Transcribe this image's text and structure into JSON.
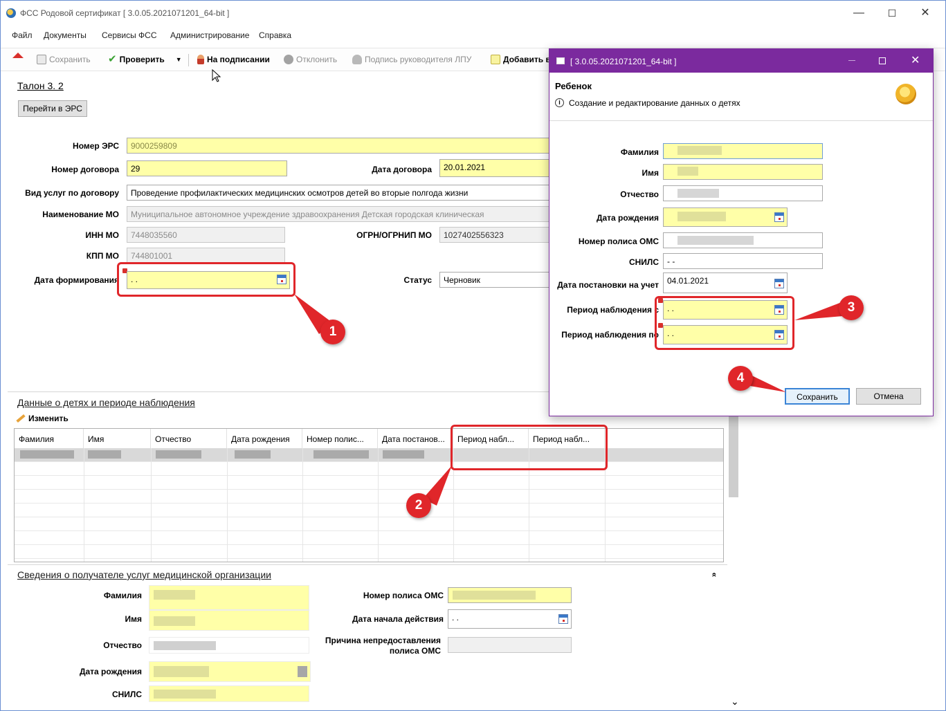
{
  "window": {
    "title": "ФСС Родовой сертификат  [ 3.0.05.2021071201_64-bit ]",
    "controls": {
      "minimize": "—",
      "maximize": "☐",
      "close": "✕"
    }
  },
  "menu": [
    "Файл",
    "Документы",
    "Сервисы ФСС",
    "Администрирование",
    "Справка"
  ],
  "toolbar": {
    "save": "Сохранить",
    "check": "Проверить",
    "on_signing": "На подписании",
    "reject": "Отклонить",
    "head_signature": "Подпись руководителя ЛПУ",
    "add": "Добавить в"
  },
  "form": {
    "title": "Талон 3. 2",
    "go_to_ers": "Перейти в ЭРС",
    "ers_number_label": "Номер ЭРС",
    "ers_number": "9000259809",
    "contract_number_label": "Номер договора",
    "contract_number": "29",
    "contract_date_label": "Дата договора",
    "contract_date": "20.01.2021",
    "service_type_label": "Вид услуг по договору",
    "service_type": "Проведение профилактических медицинских осмотров детей во вторые полгода жизни",
    "mo_name_label": "Наименование МО",
    "mo_name": "Муниципальное автономное учреждение здравоохранения Детская городская клиническая",
    "inn_label": "ИНН МО",
    "inn": "7448035560",
    "ogrn_label": "ОГРН/ОГРНИП МО",
    "ogrn": "1027402556323",
    "kpp_label": "КПП МО",
    "kpp": "744801001",
    "form_date_label": "Дата формирования",
    "form_date": " .  .",
    "status_label": "Статус",
    "status": "Черновик"
  },
  "children_section": {
    "title": "Данные о детях и периоде наблюдения",
    "edit": "Изменить",
    "columns": [
      "Фамилия",
      "Имя",
      "Отчество",
      "Дата рождения",
      "Номер полис...",
      "Дата постанов...",
      "Период набл...",
      "Период набл..."
    ]
  },
  "recipient_section": {
    "title": "Сведения о получателе услуг медицинской организации",
    "collapse": "«",
    "surname_label": "Фамилия",
    "name_label": "Имя",
    "patronymic_label": "Отчество",
    "birth_label": "Дата рождения",
    "snils_label": "СНИЛС",
    "policy_label": "Номер полиса ОМС",
    "start_date_label": "Дата начала действия",
    "start_date": " .  .",
    "reason_label_1": "Причина непредоставления",
    "reason_label_2": "полиса ОМС",
    "scroll_down": "⌄"
  },
  "dialog": {
    "title": "[ 3.0.05.2021071201_64-bit ]",
    "heading": "Ребенок",
    "info_icon_text": "i",
    "subtitle": "Создание и редактирование данных о детях",
    "surname_label": "Фамилия",
    "name_label": "Имя",
    "patronymic_label": "Отчество",
    "birth_label": "Дата рождения",
    "policy_label": "Номер полиса ОМС",
    "snils_label": "СНИЛС",
    "snils": "  -  -",
    "reg_date_label": "Дата постановки на учет",
    "reg_date": "04.01.2021",
    "period_from_label": "Период наблюдения с",
    "period_from": " .  .",
    "period_to_label": "Период наблюдения по",
    "period_to": " .  .",
    "save": "Сохранить",
    "cancel": "Отмена"
  },
  "annotations": [
    "1",
    "2",
    "3",
    "4"
  ],
  "colors": {
    "required_field": "#ffffa8",
    "annotation_red": "#e0262a",
    "dialog_titlebar": "#7b2a9e"
  }
}
